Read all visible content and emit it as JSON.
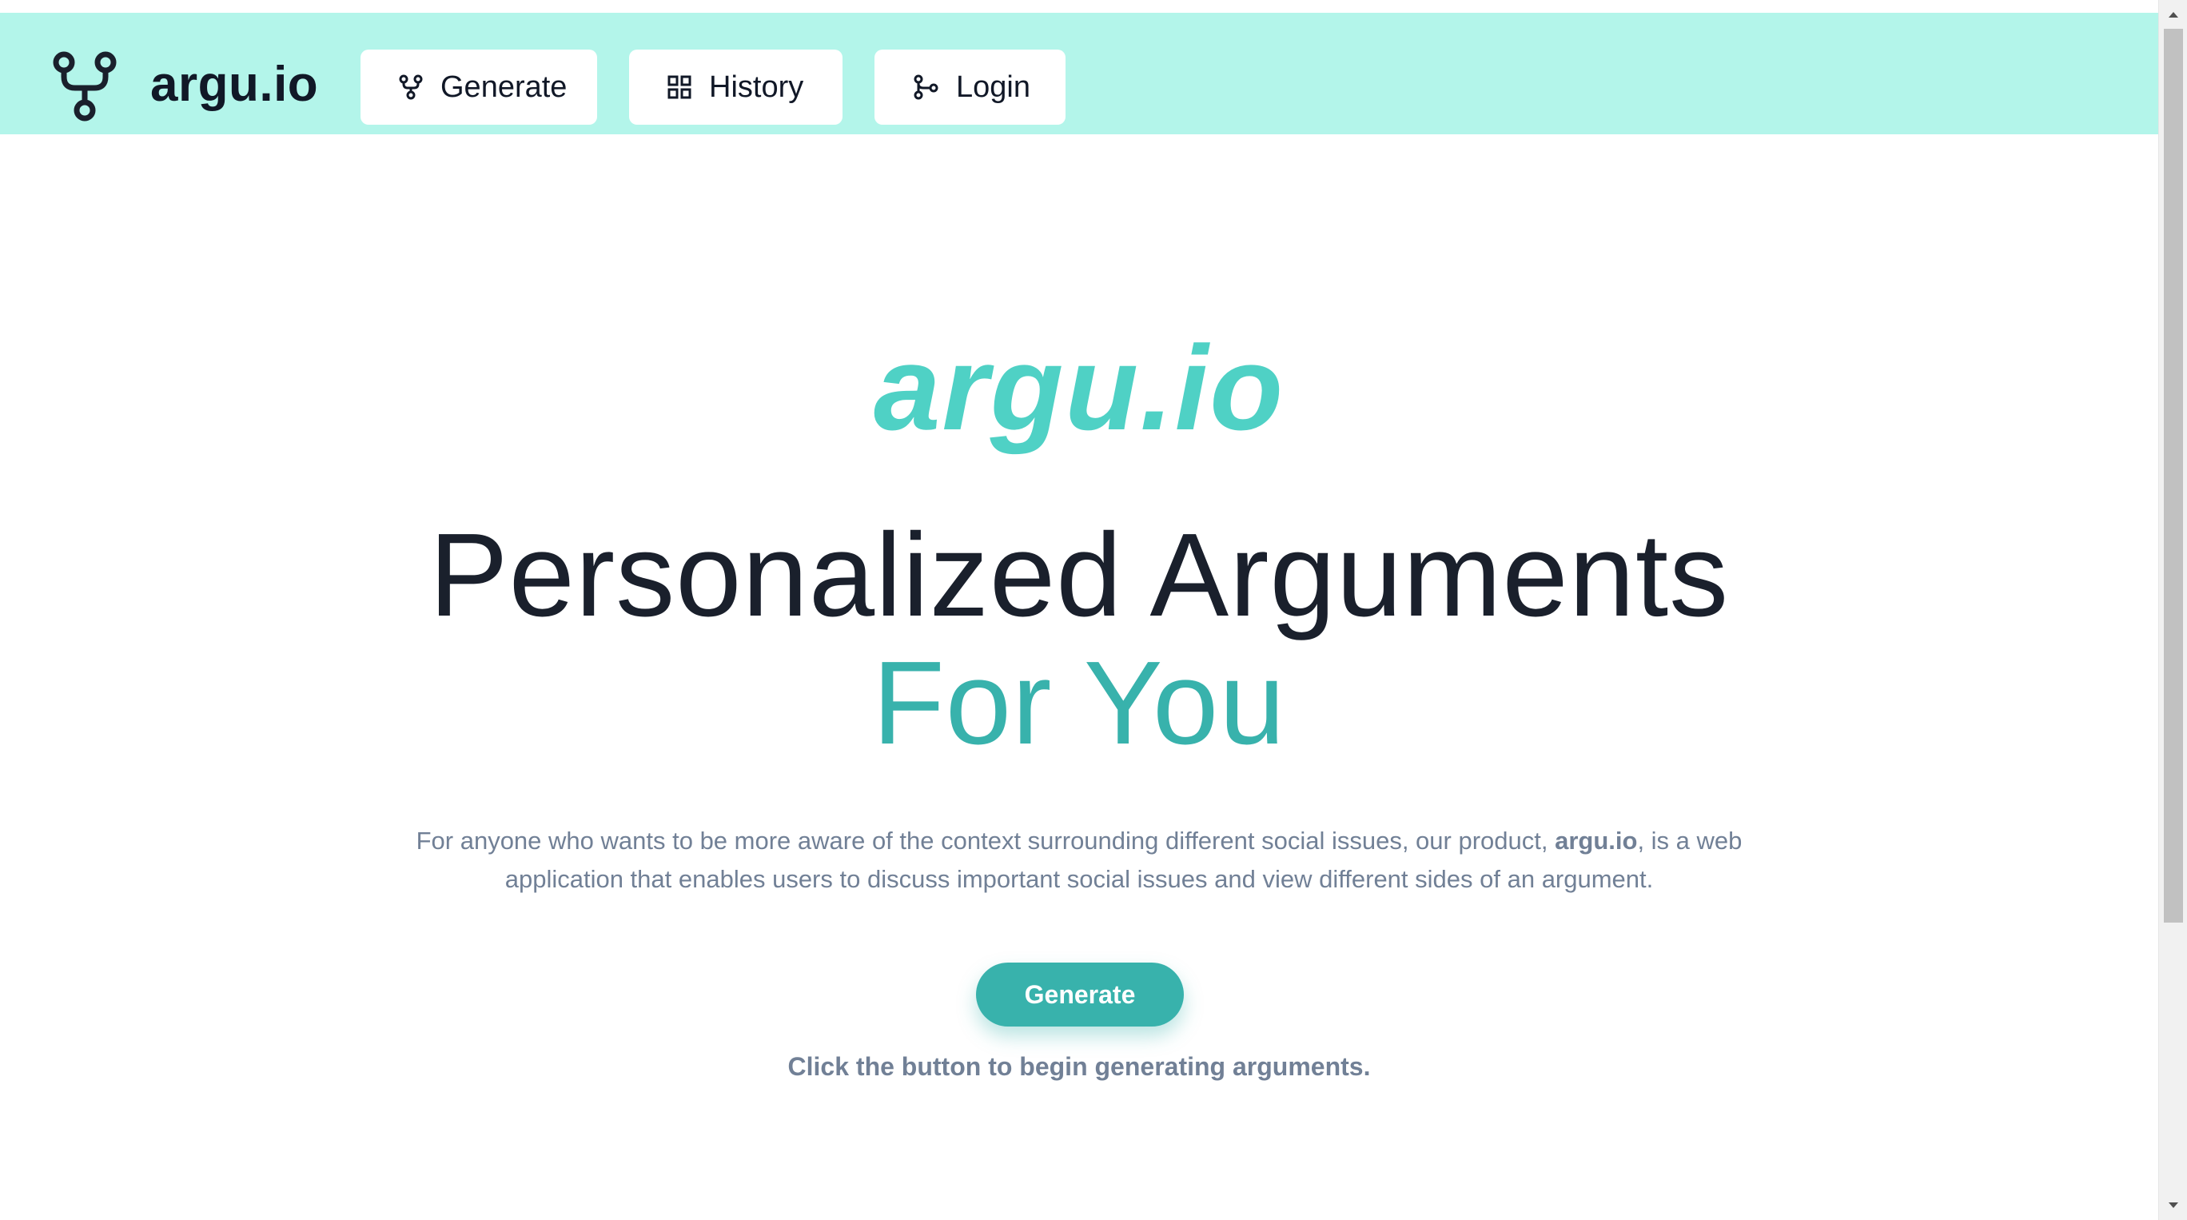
{
  "navbar": {
    "brand": "argu.io",
    "brand_icon": "branch-fork-icon",
    "items": [
      {
        "label": "Generate",
        "icon": "branch-fork-icon"
      },
      {
        "label": "History",
        "icon": "grid-icon"
      },
      {
        "label": "Login",
        "icon": "git-merge-icon"
      }
    ]
  },
  "hero": {
    "logo_text": "argu.io",
    "title": "Personalized Arguments",
    "subtitle": "For You",
    "description_before": "For anyone who wants to be more aware of the context surrounding different social issues, our product, ",
    "description_bold": "argu.io",
    "description_after": ", is a web application that enables users to discuss important social issues and view different sides of an argument.",
    "cta_label": "Generate",
    "hint": "Click the button to begin generating arguments."
  },
  "colors": {
    "navbar_bg": "#b3f5ea",
    "accent": "#38b2ac",
    "logo_teal": "#4fd1c5",
    "title_dark": "#1a202c",
    "muted_text": "#718096"
  },
  "scrollbar": {
    "up_icon": "scroll-up-arrow-icon",
    "down_icon": "scroll-down-arrow-icon"
  }
}
